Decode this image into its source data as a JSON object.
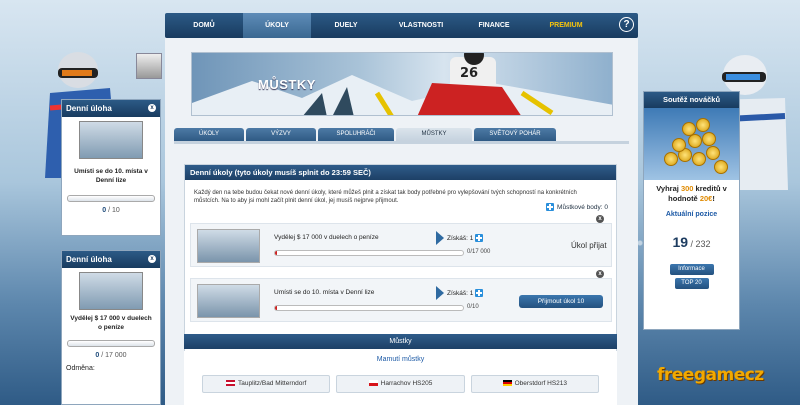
{
  "nav": {
    "items": [
      {
        "label": "DOMŮ"
      },
      {
        "label": "ÚKOLY"
      },
      {
        "label": "DUELY"
      },
      {
        "label": "VLASTNOSTI"
      },
      {
        "label": "FINANCE"
      },
      {
        "label": "PREMIUM"
      }
    ],
    "active_index": 1,
    "help_label": "?"
  },
  "banner": {
    "title": "MŮSTKY",
    "bib_number": "26"
  },
  "subtabs": [
    {
      "label": "ÚKOLY"
    },
    {
      "label": "VÝZVY"
    },
    {
      "label": "SPOLUHRÁČI"
    },
    {
      "label": "MŮSTKY"
    },
    {
      "label": "SVĚTOVÝ POHÁR"
    }
  ],
  "daily": {
    "header": "Denní úkoly (tyto úkoly musíš splnit do 23:59 SEČ)",
    "description": "Každý den na tebe budou čekat nové denní úkoly, které můžeš plnit a získat tak body potřebné pro vylepšování tvých schopností na konkrétních můstcích. Na to aby jsi mohl začít plnit denní úkol, jej musíš nejprve přijmout.",
    "bodies_label": "Můstkové body: 0",
    "tasks": [
      {
        "text": "Vydělej $ 17 000 v duelech o peníze",
        "gain": "Získáš: 1",
        "progress": "0/17 000",
        "state": "Úkol přijat",
        "close": "x"
      },
      {
        "text": "Umísti se do 10. místa v Denní lize",
        "gain": "Získáš: 1",
        "progress": "0/10",
        "accept_label": "Přijmout úkol 10",
        "close": "x"
      }
    ]
  },
  "hills": {
    "header": "Můstky",
    "subheader": "Mamutí můstky",
    "items": [
      {
        "label": "Tauplitz/Bad Mitterndorf",
        "flag_color": "#c8102e"
      },
      {
        "label": "Harrachov HS205",
        "flag_color": "#11457e"
      },
      {
        "label": "Oberstdorf HS213",
        "flag_color": "#ffce00"
      }
    ]
  },
  "widgets": [
    {
      "title": "Denní úloha",
      "text": "Umísti se do 10. místa v Denní lize",
      "count_value": "0",
      "count_total": " / 10"
    },
    {
      "title": "Denní úloha",
      "text": "Vydělej $ 17 000 v duelech o peníze",
      "count_value": "0",
      "count_total": " / 17 000",
      "footer": "Odměna:"
    }
  ],
  "contest": {
    "title": "Soutěž nováčků",
    "prize_prefix": "Vyhraj ",
    "prize_amount": "300",
    "prize_mid": " kreditů v hodnotě ",
    "prize_value": "20€",
    "prize_suffix": "!",
    "position_link": "Aktuální pozice",
    "rank": "19",
    "rank_total": " / 232",
    "info_button": "Informace",
    "top_button": "TOP 20"
  },
  "brand": "freegamecz",
  "colors": {
    "nav": "#1d4066",
    "accent": "#2a8fdb",
    "premium": "#f5c40d",
    "brand": "#f2a900"
  }
}
